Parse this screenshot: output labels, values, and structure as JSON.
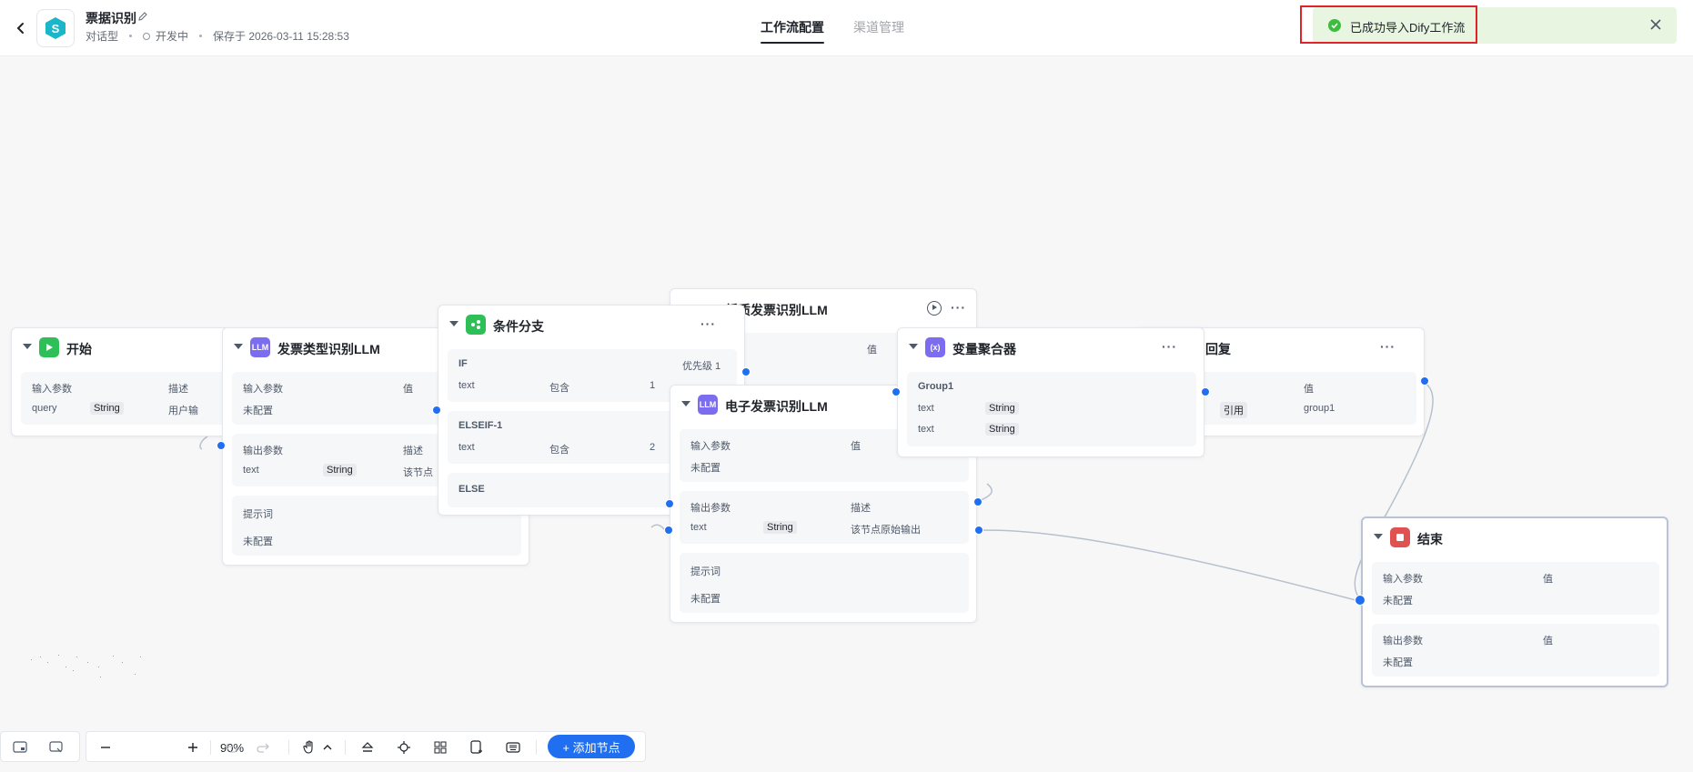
{
  "header": {
    "title": "票据识别",
    "type": "对话型",
    "status": "开发中",
    "saved_at": "保存于 2026-03-11 15:28:53",
    "tabs": [
      {
        "label": "工作流配置",
        "active": true
      },
      {
        "label": "渠道管理",
        "active": false
      }
    ]
  },
  "toast": {
    "message": "已成功导入Dify工作流",
    "color": "#e8f5e1",
    "highlight_color": "#e0242a"
  },
  "nodes": {
    "start": {
      "title": "开始",
      "icon": "play-icon",
      "color": "#2fbf58",
      "input_label": "输入参数",
      "desc_label": "描述",
      "param_name": "query",
      "param_type": "String",
      "param_desc": "用户输"
    },
    "classify_llm": {
      "title": "发票类型识别LLM",
      "icon": "llm-icon",
      "icon_text": "LLM",
      "color": "#7b6cf0",
      "input_label": "输入参数",
      "value_label": "值",
      "input_value": "未配置",
      "output_label": "输出参数",
      "desc_label": "描述",
      "out_name": "text",
      "out_type": "String",
      "out_desc": "该节点",
      "prompt_label": "提示词",
      "prompt_value": "未配置"
    },
    "branch": {
      "title": "条件分支",
      "icon": "branch-icon",
      "color": "#2fbf58",
      "if_label": "IF",
      "priority_label": "优先级 1",
      "if_var": "text",
      "if_op": "包含",
      "if_val": "1",
      "elseif_label": "ELSEIF-1",
      "elseif_var": "text",
      "elseif_op": "包含",
      "elseif_val": "2",
      "else_label": "ELSE"
    },
    "paper_llm": {
      "title": "纸质发票识别LLM",
      "value_label": "值"
    },
    "eleclm": {
      "title": "电子发票识别LLM",
      "icon_text": "LLM",
      "color": "#7b6cf0",
      "input_label": "输入参数",
      "value_label": "值",
      "input_value": "未配置",
      "output_label": "输出参数",
      "desc_label": "描述",
      "out_name": "text",
      "out_type": "String",
      "out_desc": "该节点原始输出",
      "prompt_label": "提示词",
      "prompt_value": "未配置"
    },
    "aggregator": {
      "title": "变量聚合器",
      "icon_text": "(x)",
      "color": "#7b6cf0",
      "group": "Group1",
      "rows": [
        {
          "name": "text",
          "type": "String"
        },
        {
          "name": "text",
          "type": "String"
        }
      ]
    },
    "reply": {
      "title": "回复",
      "value_label": "值",
      "ref": "引用",
      "value": "group1"
    },
    "end": {
      "title": "结束",
      "color": "#e05252",
      "input_label": "输入参数",
      "input_value_label": "值",
      "input_value": "未配置",
      "output_label": "输出参数",
      "output_value_label": "值",
      "output_value": "未配置"
    }
  },
  "toolbar": {
    "zoom": "90%",
    "add_node": "+ 添加节点"
  }
}
